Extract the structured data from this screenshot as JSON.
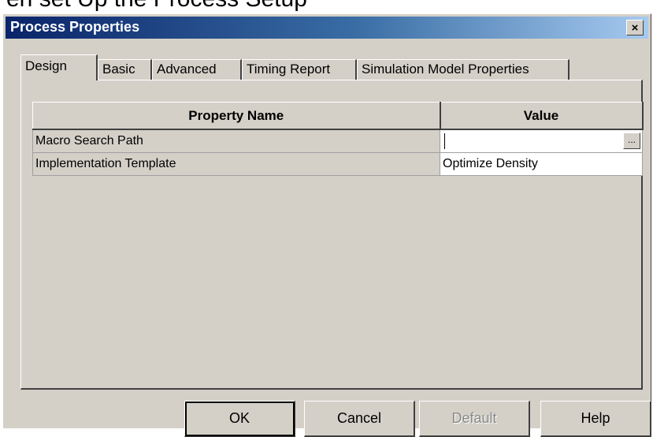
{
  "background_text": "en set Up the Process Setup",
  "window": {
    "title": "Process Properties",
    "close_label": "×"
  },
  "tabs": [
    {
      "label": "Design",
      "active": true
    },
    {
      "label": "Basic",
      "active": false
    },
    {
      "label": "Advanced",
      "active": false
    },
    {
      "label": "Timing Report",
      "active": false
    },
    {
      "label": "Simulation Model Properties",
      "active": false
    }
  ],
  "table": {
    "columns": [
      "Property Name",
      "Value"
    ],
    "rows": [
      {
        "name": "Macro Search Path",
        "value": "",
        "browse_label": "..."
      },
      {
        "name": "Implementation Template",
        "value": "Optimize Density"
      }
    ]
  },
  "buttons": {
    "ok": "OK",
    "cancel": "Cancel",
    "default": "Default",
    "help": "Help"
  },
  "colors": {
    "face": "#d4d0c8",
    "title_start": "#0a246a",
    "title_end": "#a6caf0"
  }
}
